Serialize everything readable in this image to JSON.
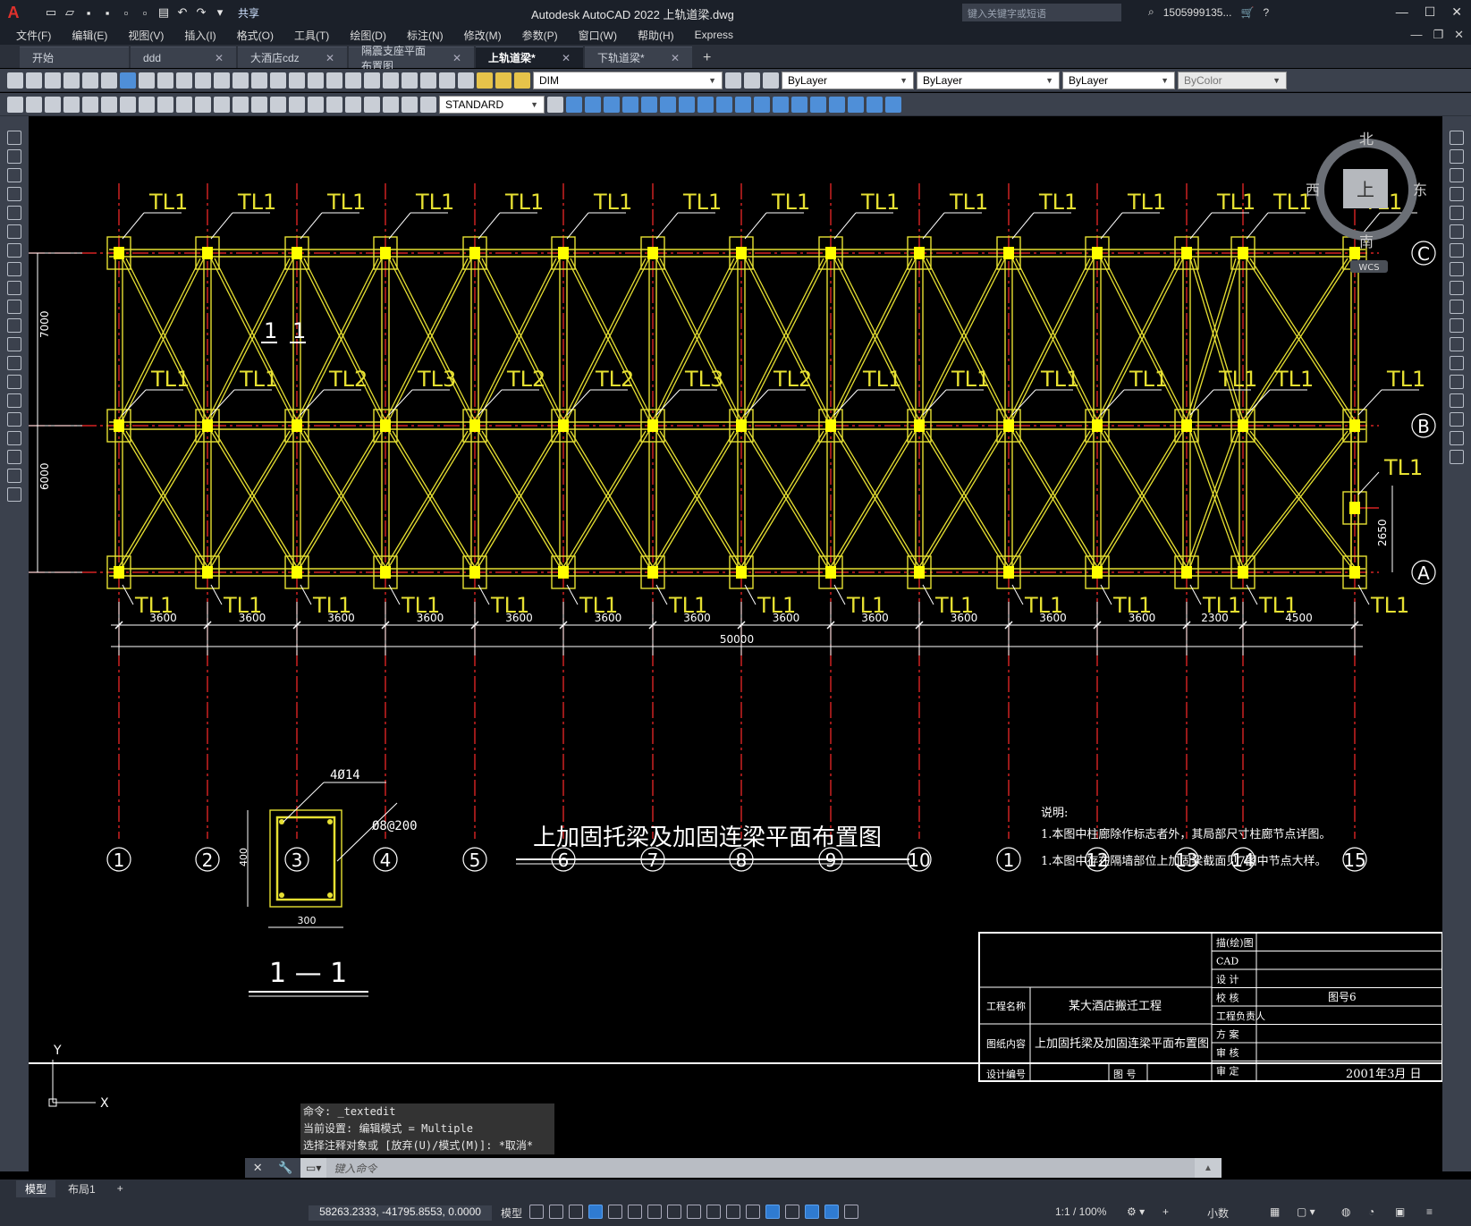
{
  "app": {
    "title": "Autodesk AutoCAD 2022    上轨道梁.dwg",
    "search_placeholder": "键入关键字或短语",
    "user": "1505999135...",
    "share": "共享"
  },
  "menu": [
    "文件(F)",
    "编辑(E)",
    "视图(V)",
    "插入(I)",
    "格式(O)",
    "工具(T)",
    "绘图(D)",
    "标注(N)",
    "修改(M)",
    "参数(P)",
    "窗口(W)",
    "帮助(H)",
    "Express"
  ],
  "tabs": [
    {
      "label": "开始",
      "closable": false
    },
    {
      "label": "ddd",
      "closable": true
    },
    {
      "label": "大酒店cdz",
      "closable": true
    },
    {
      "label": "隔震支座平面布置图",
      "closable": true
    },
    {
      "label": "上轨道梁*",
      "closable": true,
      "active": true
    },
    {
      "label": "下轨道梁*",
      "closable": true
    }
  ],
  "toolbar": {
    "layer": "DIM",
    "color": "ByLayer",
    "linetype": "ByLayer",
    "lineweight": "ByLayer",
    "plotstyle": "ByColor",
    "textstyle": "STANDARD"
  },
  "drawing": {
    "grid_cols": [
      "1",
      "2",
      "3",
      "4",
      "5",
      "6",
      "7",
      "8",
      "9",
      "10",
      "1",
      "12",
      "13",
      "14",
      "15"
    ],
    "grid_rows": [
      "C",
      "B",
      "A"
    ],
    "spans": [
      "3600",
      "3600",
      "3600",
      "3600",
      "3600",
      "3600",
      "3600",
      "3600",
      "3600",
      "3600",
      "3600",
      "3600",
      "2300",
      "4500"
    ],
    "total_dim": "50000",
    "vert_dims": [
      "7000",
      "6000"
    ],
    "extra_dim": "2650",
    "beam_label_top": "TL1",
    "beam_labels_mid": [
      "TL1",
      "TL1",
      "TL2",
      "TL3",
      "TL2",
      "TL2",
      "TL3",
      "TL2",
      "TL1",
      "TL1",
      "TL1",
      "TL1",
      "TL1",
      "TL1",
      "TL1"
    ],
    "beam_label_extra": "TL1",
    "section_mark": "1",
    "section_label": "1 — 1",
    "section_rebar_top": "4Ø14",
    "section_stirrup": "Ø8@200",
    "section_h": "400",
    "section_w": "300",
    "title": "上加固托梁及加固连梁平面布置图",
    "notes_title": "说明:",
    "notes": [
      "1.本图中柱廊除作标志者外，其局部尺寸柱廊节点详图。",
      "1.本图中存在隔墙部位上加固梁截面见7图中节点大样。"
    ],
    "compass": {
      "n": "北",
      "s": "南",
      "e": "东",
      "w": "西",
      "top": "上",
      "wcs": "WCS"
    },
    "ucs": {
      "x": "X",
      "y": "Y"
    }
  },
  "titleblock": {
    "project_label": "工程名称",
    "project": "某大酒店搬迁工程",
    "content_label": "图纸内容",
    "content": "上加固托梁及加固连梁平面布置图",
    "no_label": "设计编号",
    "drawno_label": "图 号",
    "roles": [
      "描(绘)图",
      "CAD",
      "设 计",
      "校 核",
      "工程负责人",
      "方 案",
      "审 核",
      "审 定"
    ],
    "sheet": "图号6",
    "date": "2001年3月 日"
  },
  "command": {
    "history": [
      "命令: _textedit",
      "当前设置: 编辑模式 = Multiple",
      "选择注释对象或 [放弃(U)/模式(M)]: *取消*"
    ],
    "placeholder": "键入命令"
  },
  "layouts": [
    "模型",
    "布局1"
  ],
  "status": {
    "coords": "58263.2333, -41795.8553, 0.0000",
    "model": "模型",
    "scale": "1:1 / 100%",
    "units": "小数"
  }
}
